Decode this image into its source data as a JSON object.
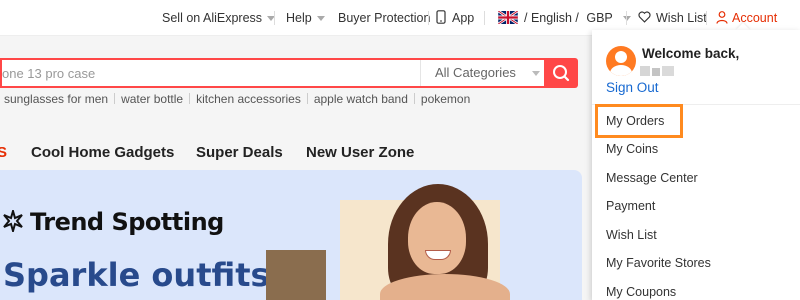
{
  "topbar": {
    "sell": "Sell on AliExpress",
    "help": "Help",
    "buyer_protection": "Buyer Protection",
    "app": "App",
    "locale": "/ English /",
    "currency": "GBP",
    "wish_list": "Wish List",
    "account": "Account"
  },
  "search": {
    "placeholder": "one 13 pro case",
    "category": "All Categories",
    "hot_words": [
      "sunglasses for men",
      "water bottle",
      "kitchen accessories",
      "apple watch band",
      "pokemon"
    ]
  },
  "nav": {
    "items": [
      "S",
      "Cool Home Gadgets",
      "Super Deals",
      "New User Zone"
    ]
  },
  "banner": {
    "title": "Trend Spotting",
    "headline": "Sparkle outfits"
  },
  "account_menu": {
    "welcome": "Welcome back,",
    "sign_out": "Sign Out",
    "items": [
      "My Orders",
      "My Coins",
      "Message Center",
      "Payment",
      "Wish List",
      "My Favorite Stores",
      "My Coupons"
    ]
  },
  "colors": {
    "accent": "#ff4747",
    "highlight": "#ff8a1f",
    "link": "#1769d1"
  },
  "icons": {
    "app": "phone-icon",
    "wish_list": "heart-icon",
    "account": "user-icon",
    "search": "search-icon",
    "trend": "sparkle-icon"
  }
}
